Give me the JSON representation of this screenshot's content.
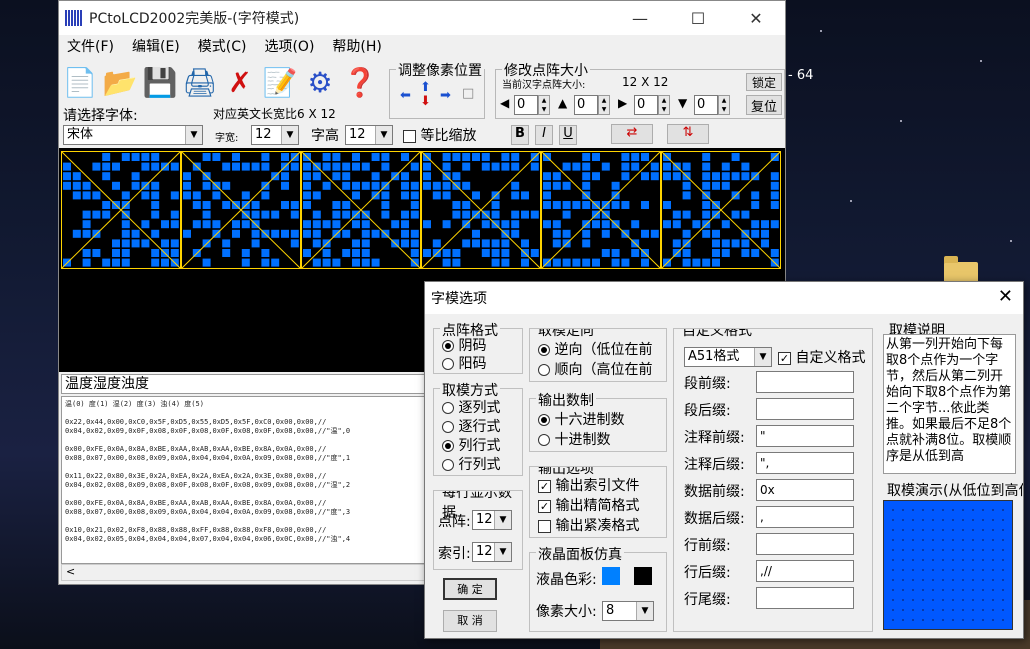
{
  "window": {
    "title": "PCtoLCD2002完美版-(字符模式)"
  },
  "desktop": {
    "taskbar_text": "- 64"
  },
  "menu": [
    "文件(F)",
    "编辑(E)",
    "模式(C)",
    "选项(O)",
    "帮助(H)"
  ],
  "toolbar_icons": [
    "new-file-icon",
    "open-folder-icon",
    "save-icon",
    "export-icon",
    "delete-icon",
    "note-icon",
    "settings-gear-icon",
    "help-icon"
  ],
  "pixel_adjust": {
    "title": "调整像素位置"
  },
  "matrix_size": {
    "title": "修改点阵大小",
    "current_label": "当前汉字点阵大小:",
    "current_value": "12 X 12",
    "lock_button": "锁定",
    "reset_button": "复位",
    "spin_values": [
      "0",
      "0",
      "0",
      "0"
    ]
  },
  "font": {
    "choose_label": "请选择字体:",
    "english_width_label": "对应英文长宽比6 X 12",
    "font_name": "宋体",
    "width_label": "字宽:",
    "width_value": "12",
    "height_label": "字高",
    "height_value": "12",
    "scale_label": "等比缩放",
    "bold": "B",
    "italic": "I",
    "underline": "U"
  },
  "preview_text": "温度湿度浊度",
  "output": {
    "index_line": "温(0) 度(1) 湿(2) 度(3) 浊(4) 度(5)",
    "lines": [
      "0x22,0x44,0x00,0xC0,0x5F,0xD5,0x55,0xD5,0x5F,0xC0,0x00,0x00,//",
      "0x04,0x02,0x09,0x0F,0x08,0x0F,0x08,0x0F,0x08,0x0F,0x08,0x00,//\"温\",0",
      "",
      "0x00,0xFE,0x0A,0x8A,0xBE,0xAA,0xAB,0xAA,0xBE,0x8A,0x0A,0x00,//",
      "0x08,0x07,0x00,0x08,0x09,0x0A,0x04,0x04,0x0A,0x09,0x08,0x00,//\"度\",1",
      "",
      "0x11,0x22,0x80,0x3E,0x2A,0xEA,0x2A,0xEA,0x2A,0x3E,0x80,0x00,//",
      "0x04,0x02,0x08,0x09,0x08,0x0F,0x08,0x0F,0x08,0x09,0x08,0x00,//\"湿\",2",
      "",
      "0x00,0xFE,0x0A,0x8A,0xBE,0xAA,0xAB,0xAA,0xBE,0x8A,0x0A,0x00,//",
      "0x08,0x07,0x00,0x08,0x09,0x0A,0x04,0x04,0x0A,0x09,0x08,0x00,//\"度\",3",
      "",
      "0x10,0x21,0x02,0xF8,0x88,0x88,0xFF,0x88,0x88,0xF8,0x00,0x00,//",
      "0x04,0x02,0x05,0x04,0x04,0x04,0x07,0x04,0x04,0x06,0x0C,0x00,//\"浊\",4"
    ]
  },
  "dialog": {
    "title": "字模选项",
    "dot_format": {
      "title": "点阵格式",
      "options": [
        "阴码",
        "阳码"
      ],
      "selected": 0
    },
    "take_mode": {
      "title": "取模方式",
      "options": [
        "逐列式",
        "逐行式",
        "列行式",
        "行列式"
      ],
      "selected": 2
    },
    "per_line": {
      "title": "每行显示数据",
      "dot_label": "点阵:",
      "dot_value": "12",
      "index_label": "索引:",
      "index_value": "12"
    },
    "direction": {
      "title": "取模走向",
      "options": [
        "逆向（低位在前",
        "顺向（高位在前"
      ],
      "selected": 0
    },
    "radix": {
      "title": "输出数制",
      "options": [
        "十六进制数",
        "十进制数"
      ],
      "selected": 0
    },
    "output_opts": {
      "title": "输出选项",
      "items": [
        {
          "label": "输出索引文件",
          "checked": true
        },
        {
          "label": "输出精简格式",
          "checked": true
        },
        {
          "label": "输出紧凑格式",
          "checked": false
        }
      ]
    },
    "lcd": {
      "title": "液晶面板仿真",
      "color_label": "液晶色彩:",
      "pixel_label": "像素大小:",
      "pixel_value": "8",
      "color_on": "#0080ff",
      "color_off": "#000000"
    },
    "custom": {
      "title": "自定义格式",
      "format_value": "A51格式",
      "custom_check_label": "自定义格式",
      "fields": [
        {
          "label": "段前缀:",
          "value": ""
        },
        {
          "label": "段后缀:",
          "value": ""
        },
        {
          "label": "注释前缀:",
          "value": "\""
        },
        {
          "label": "注释后缀:",
          "value": "\","
        },
        {
          "label": "数据前缀:",
          "value": "0x"
        },
        {
          "label": "数据后缀:",
          "value": ","
        },
        {
          "label": "行前缀:",
          "value": ""
        },
        {
          "label": "行后缀:",
          "value": ",//"
        },
        {
          "label": "行尾缀:",
          "value": ""
        }
      ]
    },
    "desc": {
      "title": "取模说明",
      "text": "从第一列开始向下每取8个点作为一个字节，然后从第二列开始向下取8个点作为第二个字节...依此类推。如果最后不足8个点就补满8位。取模顺序是从低到高"
    },
    "demo": {
      "title": "取模演示(从低位到高位)"
    },
    "ok_button": "确  定",
    "cancel_button": "取  消"
  }
}
